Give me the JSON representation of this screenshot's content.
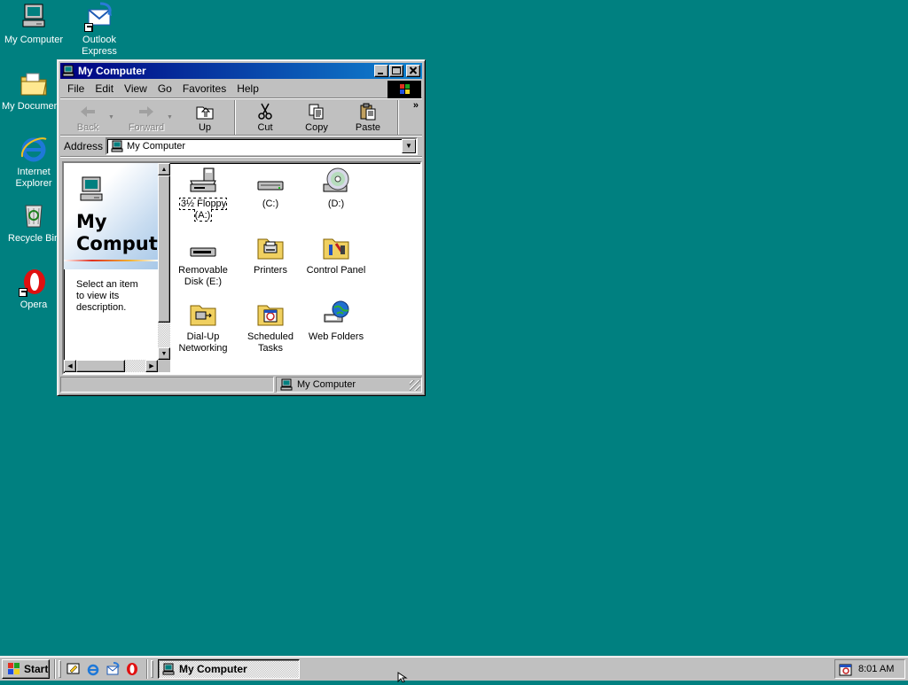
{
  "desktop": {
    "icons": [
      {
        "label": "My Computer",
        "icon": "computer-icon"
      },
      {
        "label": "Outlook Express",
        "label_line1": "Outlook",
        "label_line2": "Express",
        "icon": "outlook-express-icon"
      },
      {
        "label": "My Documents",
        "icon": "folder-documents-icon"
      },
      {
        "label": "Internet Explorer",
        "label_line1": "Internet",
        "label_line2": "Explorer",
        "icon": "internet-explorer-icon"
      },
      {
        "label": "Recycle Bin",
        "icon": "recycle-bin-icon"
      },
      {
        "label": "Opera",
        "icon": "opera-icon"
      }
    ]
  },
  "window": {
    "title": "My Computer",
    "menu": [
      "File",
      "Edit",
      "View",
      "Go",
      "Favorites",
      "Help"
    ],
    "toolbar": {
      "back": "Back",
      "forward": "Forward",
      "up": "Up",
      "cut": "Cut",
      "copy": "Copy",
      "paste": "Paste",
      "more": "»"
    },
    "address": {
      "label": "Address",
      "value": "My Computer"
    },
    "left_pane": {
      "title_line1": "My",
      "title_line2": "Computer",
      "description": "Select an item to view its description."
    },
    "items": [
      {
        "label": "3½ Floppy (A:)",
        "icon": "floppy-drive-icon"
      },
      {
        "label": "(C:)",
        "icon": "hard-drive-icon"
      },
      {
        "label": "(D:)",
        "icon": "cd-drive-icon"
      },
      {
        "label_line1": "Removable",
        "label_line2": "Disk (E:)",
        "icon": "removable-disk-icon"
      },
      {
        "label": "Printers",
        "icon": "printers-folder-icon"
      },
      {
        "label": "Control Panel",
        "icon": "control-panel-icon"
      },
      {
        "label_line1": "Dial-Up",
        "label_line2": "Networking",
        "icon": "dial-up-networking-icon"
      },
      {
        "label_line1": "Scheduled",
        "label_line2": "Tasks",
        "icon": "scheduled-tasks-icon"
      },
      {
        "label": "Web Folders",
        "icon": "web-folders-icon"
      }
    ],
    "status": {
      "right": "My Computer"
    }
  },
  "taskbar": {
    "start_label": "Start",
    "quick_launch": [
      "show-desktop-icon",
      "internet-explorer-icon",
      "outlook-express-icon",
      "opera-icon"
    ],
    "task_button": "My Computer",
    "clock": "8:01 AM"
  },
  "colors": {
    "desktop": "#008080",
    "title_start": "#000080",
    "title_end": "#1084d0",
    "face": "#c0c0c0"
  }
}
